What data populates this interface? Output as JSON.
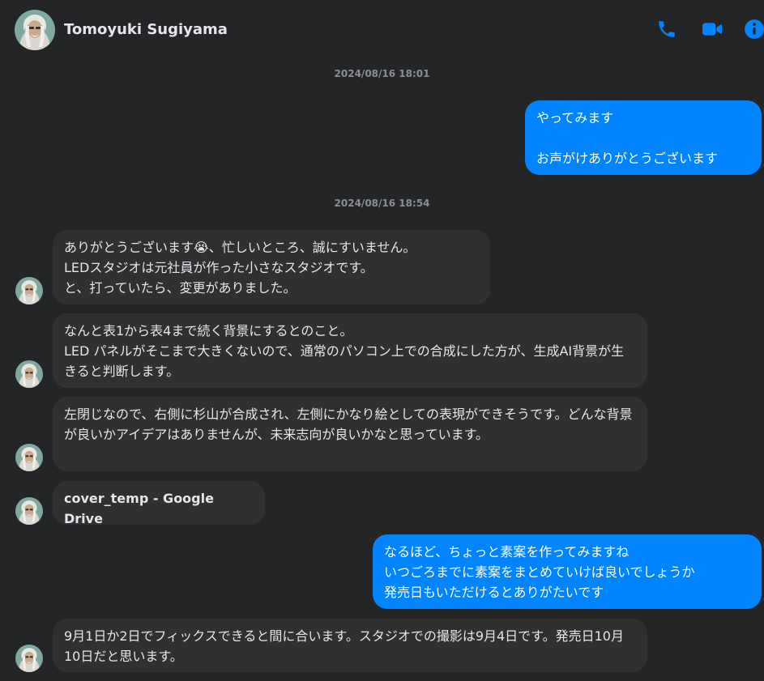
{
  "header": {
    "contact_name": "Tomoyuki Sugiyama",
    "icons": [
      "phone-icon",
      "video-call-icon",
      "info-icon"
    ],
    "accent_color": "#0084ff"
  },
  "conversation": {
    "timestamps": [
      "2024/08/16 18:01",
      "2024/08/16 18:54"
    ],
    "messages": [
      {
        "direction": "outgoing",
        "text": "やってみます\n\nお声がけありがとうございます"
      },
      {
        "direction": "incoming",
        "text": "ありがとうございます😭、忙しいところ、誠にすいません。\nLEDスタジオは元社員が作った小さなスタジオです。\nと、打っていたら、変更がありました。"
      },
      {
        "direction": "incoming",
        "text": "なんと表1から表4まで続く背景にするとのこと。\nLED パネルがそこまで大きくないので、通常のパソコン上での合成にした方が、生成AI背景が生きると判断します。"
      },
      {
        "direction": "incoming",
        "text": "左閉じなので、右側に杉山が合成され、左側にかなり絵としての表現ができそうです。どんな背景が良いかアイデアはありませんが、未来志向が良いかなと思っています。"
      },
      {
        "direction": "incoming",
        "text": "cover_temp - Google Drive"
      },
      {
        "direction": "outgoing",
        "text": "なるほど、ちょっと素案を作ってみますね\nいつごろまでに素案をまとめていけば良いでしょうか\n発売日もいただけるとありがたいです"
      },
      {
        "direction": "incoming",
        "text": "9月1日か2日でフィックスできると間に合います。スタジオでの撮影は9月4日です。発売日10月10日だと思います。"
      }
    ]
  }
}
